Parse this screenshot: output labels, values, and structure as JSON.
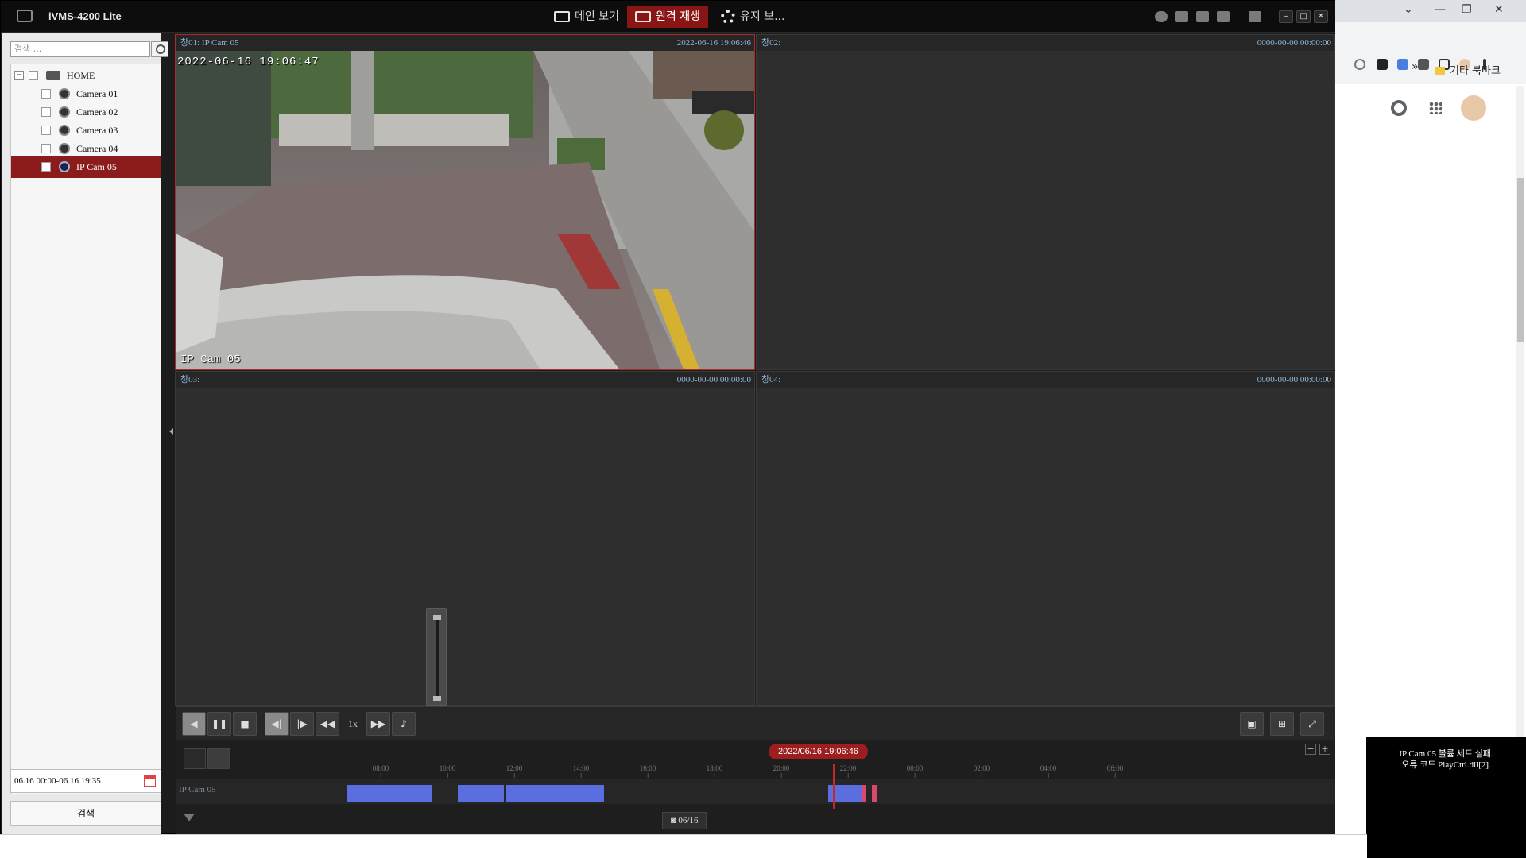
{
  "app": {
    "name": "iVMS-4200 Lite",
    "tabs": [
      {
        "label": "메인 보기"
      },
      {
        "label": "원격 재생"
      },
      {
        "label": "유지 보..."
      }
    ]
  },
  "sidebar": {
    "search_placeholder": "검색 ...",
    "tree": [
      {
        "label": "HOME"
      },
      {
        "label": "Camera 01"
      },
      {
        "label": "Camera 02"
      },
      {
        "label": "Camera 03"
      },
      {
        "label": "Camera 04"
      },
      {
        "label": "IP Cam 05"
      }
    ],
    "date_range": "06.16 00:00-06.16 19:35",
    "search_button": "검색"
  },
  "windows": [
    {
      "title": "창01:  IP Cam 05",
      "timestamp": "2022-06-16 19:06:46",
      "osd_time": "2022-06-16 19:06:47",
      "osd_name": "IP Cam 05"
    },
    {
      "title": "창02:",
      "timestamp": "0000-00-00 00:00:00"
    },
    {
      "title": "창03:",
      "timestamp": "0000-00-00 00:00:00"
    },
    {
      "title": "창04:",
      "timestamp": "0000-00-00 00:00:00"
    }
  ],
  "controls": {
    "speed": "1x"
  },
  "timeline": {
    "current_time": "2022/06/16 19:06:46",
    "track_name": "IP Cam 05",
    "day_badge": "06/16",
    "ticks": [
      "08:00",
      "10:00",
      "12:00",
      "14:00",
      "16:00",
      "18:00",
      "20:00",
      "22:00",
      "00:00",
      "02:00",
      "04:00",
      "06:00"
    ],
    "colors": {
      "record": "#5b6ee0",
      "alarm": "#d94a6a",
      "cursor": "#c62828"
    }
  },
  "browser": {
    "bookmark_folder": "기타 북마크",
    "chevron": "»"
  },
  "toast": {
    "line1": "IP Cam 05 볼륨 세트 실패.",
    "line2": "오류 코드 PlayCtrl.dll[2]."
  }
}
